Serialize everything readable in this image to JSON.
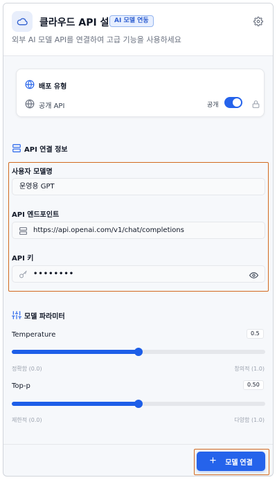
{
  "header": {
    "title": "클라우드 API 설정",
    "badge": "AI 모델 연동",
    "subtitle": "외부 AI 모델 API를 연결하여 고급 기능을 사용하세요"
  },
  "deploy": {
    "title": "배포 유형",
    "option_label": "공개 API",
    "toggle_label": "공개",
    "toggle_on": true
  },
  "api_section": {
    "title": "API 연결 정보",
    "fields": [
      {
        "label": "사용자 모델명",
        "value": "운영용 GPT"
      },
      {
        "label": "API 엔드포인트",
        "value": "https://api.openai.com/v1/chat/completions"
      },
      {
        "label": "API 키",
        "value": "••••••••"
      }
    ]
  },
  "params": {
    "title": "모델 파라미터",
    "temperature": {
      "label": "Temperature",
      "value": "0.5",
      "fraction": 0.5,
      "min_label": "정확함 (0.0)",
      "max_label": "창의적 (1.0)"
    },
    "top_p": {
      "label": "Top-p",
      "value": "0.50",
      "fraction": 0.5,
      "min_label": "제한적 (0.0)",
      "max_label": "다양함 (1.0)"
    }
  },
  "footer": {
    "connect_label": "모델 연결"
  },
  "colors": {
    "accent": "#2563eb",
    "highlight_border": "#d2691e"
  },
  "icons": [
    "cloud-icon",
    "gear-icon",
    "globe-icon",
    "lock-icon",
    "server-icon",
    "key-icon",
    "eye-icon",
    "sliders-icon",
    "plus-icon"
  ]
}
